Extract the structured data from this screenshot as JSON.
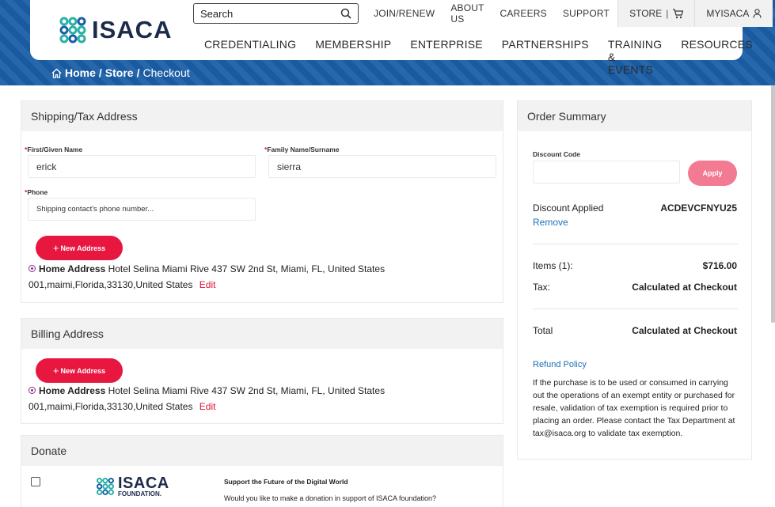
{
  "header": {
    "logo_text": "ISACA",
    "search": {
      "placeholder": "Search"
    },
    "utility_nav": [
      "JOIN/RENEW",
      "ABOUT US",
      "CAREERS",
      "SUPPORT"
    ],
    "store_label": "STORE",
    "myisaca_label": "MYISACA",
    "main_nav": [
      "CREDENTIALING",
      "MEMBERSHIP",
      "ENTERPRISE",
      "PARTNERSHIPS",
      "TRAINING & EVENTS",
      "RESOURCES"
    ]
  },
  "breadcrumb": {
    "home": "Home",
    "sep1": "/",
    "store": "Store",
    "sep2": "/",
    "current": "Checkout"
  },
  "shipping": {
    "title": "Shipping/Tax Address",
    "first_name_label": "First/Given Name",
    "first_name_value": "erick",
    "family_name_label": "Family Name/Surname",
    "family_name_value": "sierra",
    "phone_label": "Phone",
    "phone_placeholder": "Shipping contact's phone number...",
    "required_mark": "*",
    "new_address_label": "New Address",
    "address_title": "Home Address",
    "address_line1": "Hotel Selina Miami Rive 437 SW 2nd St, Miami, FL, United States",
    "address_line2": "001,maimi,Florida,33130,United States",
    "edit_label": "Edit"
  },
  "billing": {
    "title": "Billing Address",
    "new_address_label": "New Address",
    "address_title": "Home Address",
    "address_line1": "Hotel Selina Miami Rive 437 SW 2nd St, Miami, FL, United States",
    "address_line2": "001,maimi,Florida,33130,United States",
    "edit_label": "Edit"
  },
  "donate": {
    "title": "Donate",
    "logo_text": "ISACA",
    "logo_sub": "FOUNDATION.",
    "heading": "Support the Future of the Digital World",
    "question": "Would you like to make a donation in support of ISACA foundation?"
  },
  "summary": {
    "title": "Order Summary",
    "discount_label": "Discount Code",
    "apply_label": "Apply",
    "discount_applied_label": "Discount Applied",
    "discount_code_value": "ACDEVCFNYU25",
    "remove_label": "Remove",
    "items_label": "Items (1):",
    "items_value": "$716.00",
    "tax_label": "Tax:",
    "tax_value": "Calculated at Checkout",
    "total_label": "Total",
    "total_value": "Calculated at Checkout",
    "refund_label": "Refund Policy",
    "refund_text": "If the purchase is to be used or consumed in carrying out the operations of an exempt entity or purchased for resale, validation of tax exemption is required prior to placing an order. Please contact the Tax Department at tax@isaca.org to validate tax exemption."
  },
  "colors": {
    "brand_blue": "#1b5fa8",
    "accent_red": "#e8173f",
    "apply_pink": "#f27a92",
    "link_blue": "#1e6fb8"
  }
}
